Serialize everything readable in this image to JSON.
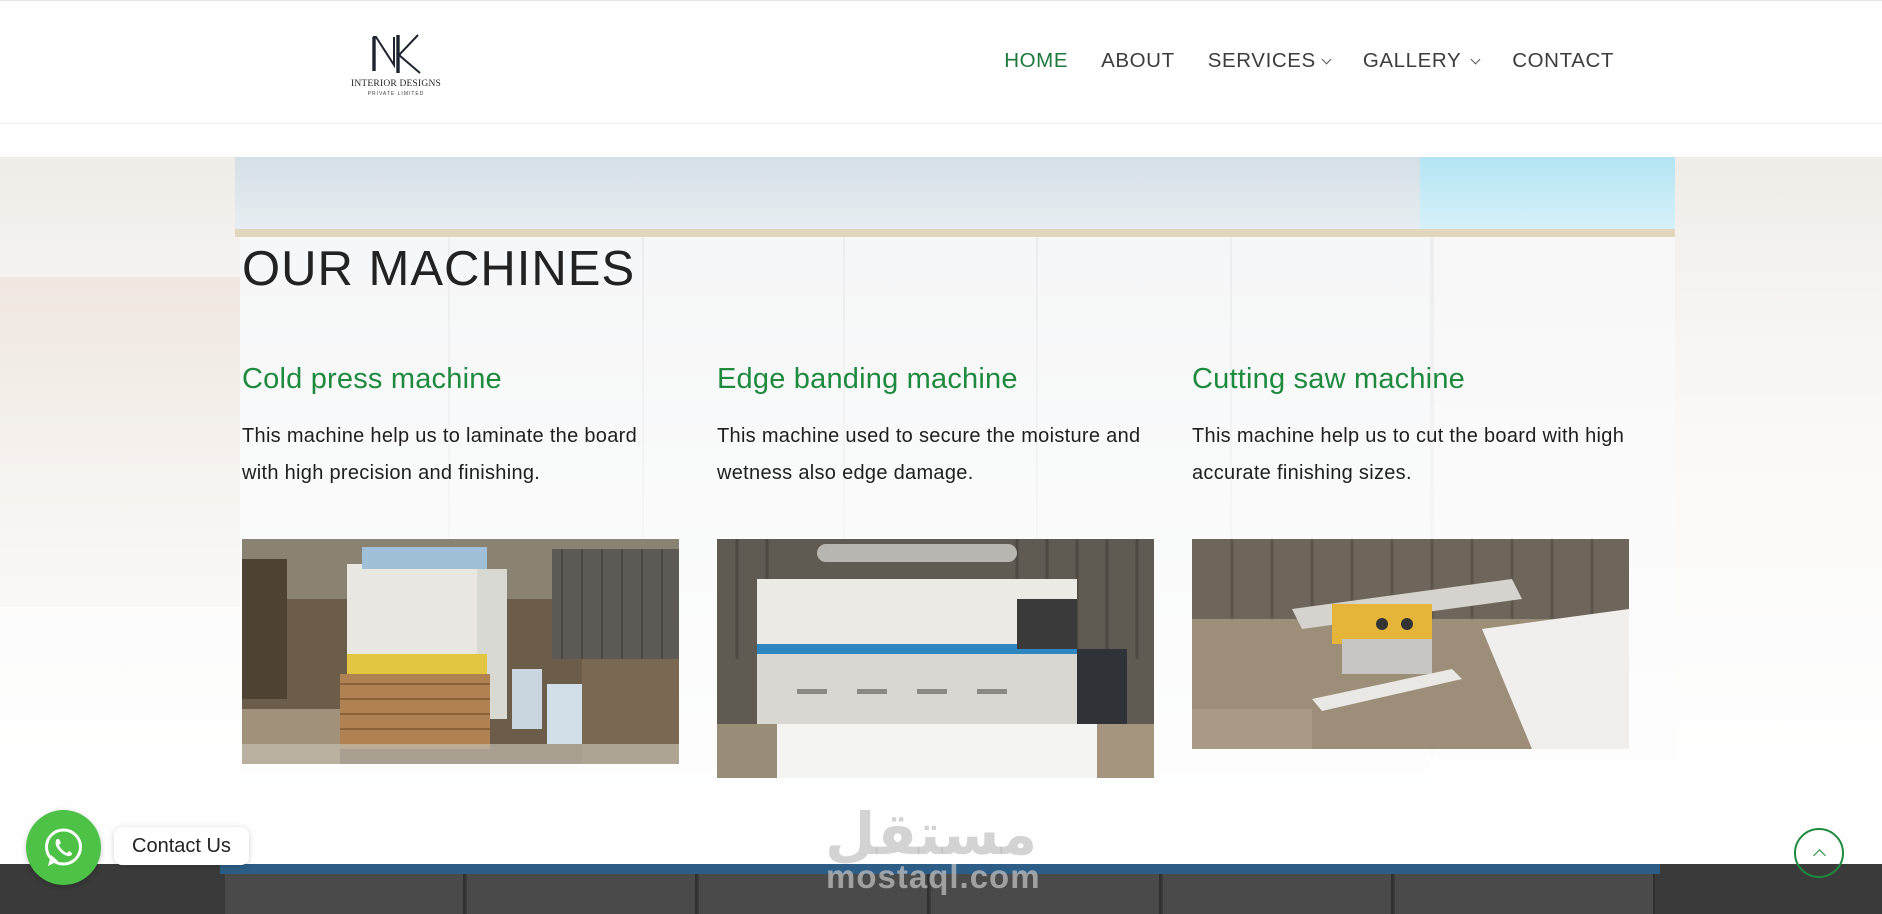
{
  "brand": {
    "logo_monogram": "NK",
    "logo_line1": "INTERIOR DESIGNS",
    "logo_line2": "PRIVATE LIMITED"
  },
  "nav": {
    "items": [
      {
        "label": "HOME",
        "active": true,
        "has_dropdown": false
      },
      {
        "label": "ABOUT",
        "active": false,
        "has_dropdown": false
      },
      {
        "label": "SERVICES",
        "active": false,
        "has_dropdown": true
      },
      {
        "label": "GALLERY",
        "active": false,
        "has_dropdown": true
      },
      {
        "label": "CONTACT",
        "active": false,
        "has_dropdown": false
      }
    ]
  },
  "section": {
    "title": "OUR MACHINES"
  },
  "machines": [
    {
      "title": "Cold press machine",
      "description": "This machine help us to laminate the board with high precision and finishing."
    },
    {
      "title": "Edge banding machine",
      "description": "This machine used to secure the moisture and wetness also edge damage."
    },
    {
      "title": "Cutting saw machine",
      "description": "This machine help us to cut the board with high accurate finishing sizes."
    }
  ],
  "widgets": {
    "whatsapp_label": "Contact Us",
    "watermark_ar": "مستقل",
    "watermark_en": "mostaql.com"
  },
  "colors": {
    "accent_green": "#1e8a3e",
    "nav_active": "#1e7a3c",
    "whatsapp": "#4dc247"
  },
  "icons": {
    "whatsapp": "whatsapp-icon",
    "scroll_top": "chevron-up-icon",
    "dropdown": "chevron-down-icon"
  }
}
